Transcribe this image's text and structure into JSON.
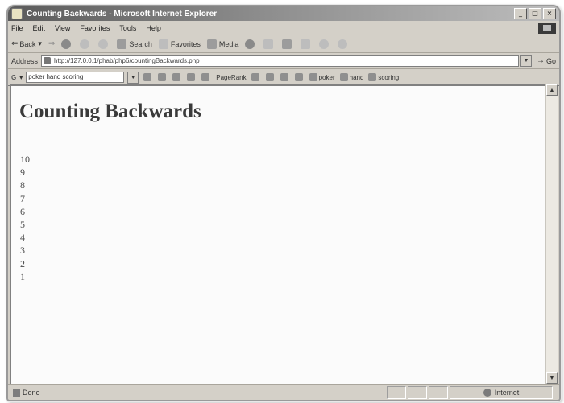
{
  "window": {
    "title": "Counting Backwards - Microsoft Internet Explorer",
    "controls": [
      "_",
      "□",
      "×"
    ]
  },
  "menubar": {
    "items": [
      "File",
      "Edit",
      "View",
      "Favorites",
      "Tools",
      "Help"
    ]
  },
  "toolbar": {
    "back_label": "Back",
    "search_label": "Search",
    "favorites_label": "Favorites",
    "media_label": "Media"
  },
  "addressbar": {
    "label": "Address",
    "url": "http://127.0.0.1/phab/php6/countingBackwards.php",
    "go_label": "Go"
  },
  "googlebar": {
    "search_value": "poker hand scoring",
    "pagerank_label": "PageRank",
    "term_buttons": [
      "poker",
      "hand",
      "scoring"
    ]
  },
  "page": {
    "heading": "Counting Backwards",
    "numbers": [
      "10",
      "9",
      "8",
      "7",
      "6",
      "5",
      "4",
      "3",
      "2",
      "1"
    ]
  },
  "statusbar": {
    "status_text": "Done",
    "zone_text": "Internet"
  }
}
